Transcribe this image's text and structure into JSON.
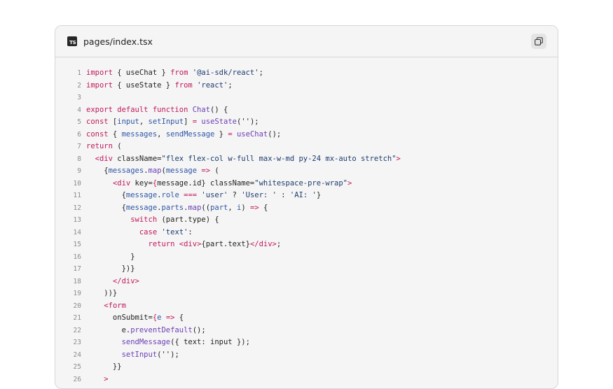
{
  "header": {
    "file_icon": "typescript-file-icon",
    "file_icon_label": "TS",
    "filename": "pages/index.tsx",
    "copy_icon": "copy-icon"
  },
  "colors": {
    "keyword": "#c2185b",
    "function": "#6a3fb5",
    "string": "#1d3c6e",
    "variable": "#2f55a5",
    "line_number": "#8c8c8c",
    "card_background": "#f5f5f5",
    "border": "#d6d6d6"
  },
  "code_lines": [
    {
      "n": "1",
      "tokens": [
        [
          "kw",
          "import"
        ],
        [
          "txt",
          " { useChat } "
        ],
        [
          "kw",
          "from"
        ],
        [
          "txt",
          " "
        ],
        [
          "str",
          "'@ai-sdk/react'"
        ],
        [
          "txt",
          ";"
        ]
      ]
    },
    {
      "n": "2",
      "tokens": [
        [
          "kw",
          "import"
        ],
        [
          "txt",
          " { useState } "
        ],
        [
          "kw",
          "from"
        ],
        [
          "txt",
          " "
        ],
        [
          "str",
          "'react'"
        ],
        [
          "txt",
          ";"
        ]
      ]
    },
    {
      "n": "3",
      "tokens": []
    },
    {
      "n": "4",
      "tokens": [
        [
          "kw",
          "export default function"
        ],
        [
          "txt",
          " "
        ],
        [
          "fn",
          "Chat"
        ],
        [
          "txt",
          "() {"
        ]
      ]
    },
    {
      "n": "5",
      "tokens": [
        [
          "kw",
          "const"
        ],
        [
          "txt",
          " ["
        ],
        [
          "var",
          "input"
        ],
        [
          "txt",
          ", "
        ],
        [
          "var",
          "setInput"
        ],
        [
          "txt",
          "] "
        ],
        [
          "kw",
          "="
        ],
        [
          "txt",
          " "
        ],
        [
          "fn",
          "useState"
        ],
        [
          "txt",
          "('');"
        ]
      ]
    },
    {
      "n": "6",
      "tokens": [
        [
          "kw",
          "const"
        ],
        [
          "txt",
          " { "
        ],
        [
          "var",
          "messages"
        ],
        [
          "txt",
          ", "
        ],
        [
          "var",
          "sendMessage"
        ],
        [
          "txt",
          " } "
        ],
        [
          "kw",
          "="
        ],
        [
          "txt",
          " "
        ],
        [
          "fn",
          "useChat"
        ],
        [
          "txt",
          "();"
        ]
      ]
    },
    {
      "n": "7",
      "tokens": [
        [
          "kw",
          "return"
        ],
        [
          "txt",
          " ("
        ]
      ]
    },
    {
      "n": "8",
      "tokens": [
        [
          "txt",
          "  "
        ],
        [
          "tag",
          "<div"
        ],
        [
          "txt",
          " className="
        ],
        [
          "str",
          "\"flex flex-col w-full max-w-md py-24 mx-auto stretch\""
        ],
        [
          "tag",
          ">"
        ]
      ]
    },
    {
      "n": "9",
      "tokens": [
        [
          "txt",
          "    {"
        ],
        [
          "var",
          "messages"
        ],
        [
          "txt",
          "."
        ],
        [
          "fn",
          "map"
        ],
        [
          "txt",
          "("
        ],
        [
          "var",
          "message"
        ],
        [
          "txt",
          " "
        ],
        [
          "kw",
          "=>"
        ],
        [
          "txt",
          " ("
        ]
      ]
    },
    {
      "n": "10",
      "tokens": [
        [
          "txt",
          "      "
        ],
        [
          "tag",
          "<div"
        ],
        [
          "txt",
          " key="
        ],
        [
          "kw",
          "{"
        ],
        [
          "txt",
          "message.id} className="
        ],
        [
          "str",
          "\"whitespace-pre-wrap\""
        ],
        [
          "tag",
          ">"
        ]
      ]
    },
    {
      "n": "11",
      "tokens": [
        [
          "txt",
          "        {"
        ],
        [
          "var",
          "message"
        ],
        [
          "txt",
          "."
        ],
        [
          "var",
          "role"
        ],
        [
          "txt",
          " "
        ],
        [
          "kw",
          "==="
        ],
        [
          "txt",
          " "
        ],
        [
          "str",
          "'user'"
        ],
        [
          "txt",
          " ? "
        ],
        [
          "str",
          "'User: '"
        ],
        [
          "txt",
          " : "
        ],
        [
          "str",
          "'AI: '"
        ],
        [
          "txt",
          "}"
        ]
      ]
    },
    {
      "n": "12",
      "tokens": [
        [
          "txt",
          "        {"
        ],
        [
          "var",
          "message"
        ],
        [
          "txt",
          "."
        ],
        [
          "var",
          "parts"
        ],
        [
          "txt",
          "."
        ],
        [
          "fn",
          "map"
        ],
        [
          "txt",
          "(("
        ],
        [
          "var",
          "part"
        ],
        [
          "txt",
          ", "
        ],
        [
          "var",
          "i"
        ],
        [
          "txt",
          ") "
        ],
        [
          "kw",
          "=>"
        ],
        [
          "txt",
          " {"
        ]
      ]
    },
    {
      "n": "13",
      "tokens": [
        [
          "txt",
          "          "
        ],
        [
          "kw",
          "switch"
        ],
        [
          "txt",
          " (part.type) {"
        ]
      ]
    },
    {
      "n": "14",
      "tokens": [
        [
          "txt",
          "            "
        ],
        [
          "kw",
          "case"
        ],
        [
          "txt",
          " "
        ],
        [
          "str",
          "'text'"
        ],
        [
          "txt",
          ":"
        ]
      ]
    },
    {
      "n": "15",
      "tokens": [
        [
          "txt",
          "              "
        ],
        [
          "kw",
          "return"
        ],
        [
          "txt",
          " "
        ],
        [
          "tag",
          "<div>"
        ],
        [
          "txt",
          "{part.text}"
        ],
        [
          "tag",
          "</div>"
        ],
        [
          "txt",
          ";"
        ]
      ]
    },
    {
      "n": "16",
      "tokens": [
        [
          "txt",
          "          }"
        ]
      ]
    },
    {
      "n": "17",
      "tokens": [
        [
          "txt",
          "        })}"
        ]
      ]
    },
    {
      "n": "18",
      "tokens": [
        [
          "txt",
          "      "
        ],
        [
          "tag",
          "</div>"
        ]
      ]
    },
    {
      "n": "19",
      "tokens": [
        [
          "txt",
          "    ))}"
        ]
      ]
    },
    {
      "n": "20",
      "tokens": [
        [
          "txt",
          "    "
        ],
        [
          "tag",
          "<form"
        ]
      ]
    },
    {
      "n": "21",
      "tokens": [
        [
          "txt",
          "      onSubmit="
        ],
        [
          "kw",
          "{"
        ],
        [
          "var",
          "e"
        ],
        [
          "txt",
          " "
        ],
        [
          "kw",
          "=>"
        ],
        [
          "txt",
          " {"
        ]
      ]
    },
    {
      "n": "22",
      "tokens": [
        [
          "txt",
          "        e."
        ],
        [
          "fn",
          "preventDefault"
        ],
        [
          "txt",
          "();"
        ]
      ]
    },
    {
      "n": "23",
      "tokens": [
        [
          "txt",
          "        "
        ],
        [
          "fn",
          "sendMessage"
        ],
        [
          "txt",
          "({ text: input });"
        ]
      ]
    },
    {
      "n": "24",
      "tokens": [
        [
          "txt",
          "        "
        ],
        [
          "fn",
          "setInput"
        ],
        [
          "txt",
          "('');"
        ]
      ]
    },
    {
      "n": "25",
      "tokens": [
        [
          "txt",
          "      }}"
        ]
      ]
    },
    {
      "n": "26",
      "tokens": [
        [
          "txt",
          "    "
        ],
        [
          "tag",
          ">"
        ]
      ]
    }
  ]
}
